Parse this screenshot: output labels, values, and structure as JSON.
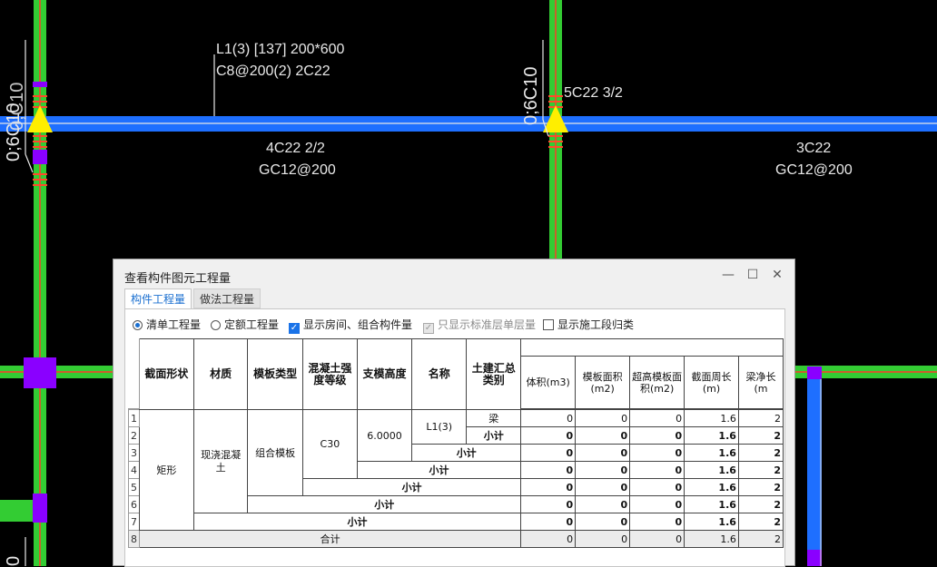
{
  "cad": {
    "beam_label_line1": "L1(3) [137] 200*600",
    "beam_label_line2": "C8@200(2) 2C22",
    "top_rebar_right": "5C22 3/2",
    "bottom_rebar_left": "4C22 2/2",
    "side_rebar_left": "GC12@200",
    "bottom_rebar_right": "3C22",
    "side_rebar_right": "GC12@200",
    "column_left_tag": "0;6C10",
    "column_left_tag_overlap": "0;C10",
    "column_mid_tag": "0;6C10",
    "column_bottom_tag": "0",
    "colors": {
      "beam": "#1e6fff",
      "column": "#33cc33",
      "node": "#8a00ff",
      "rebar": "#ff4a2a",
      "support": "#ffee00"
    }
  },
  "dialog": {
    "title": "查看构件图元工程量",
    "buttons": {
      "minimize": "—",
      "maximize": "☐",
      "close": "✕"
    },
    "tabs": [
      "构件工程量",
      "做法工程量"
    ],
    "options": {
      "radio_bill": "清单工程量",
      "radio_quota": "定额工程量",
      "chk_rooms": "显示房间、组合构件量",
      "chk_std_floor": "只显示标准层单层量",
      "chk_segments": "显示施工段归类"
    },
    "table": {
      "headers": [
        "截面形状",
        "材质",
        "模板类型",
        "混凝土强度等级",
        "支模高度",
        "名称",
        "土建汇总类别",
        "体积(m3)",
        "模板面积(m2)",
        "超高模板面积(m2)",
        "截面周长(m)",
        "梁净长(m"
      ],
      "row_numbers": [
        "1",
        "2",
        "3",
        "4",
        "5",
        "6",
        "7",
        "8"
      ],
      "shape": "矩形",
      "material": "现浇混凝土",
      "formwork": "组合模板",
      "concrete": "C30",
      "height": "6.0000",
      "name": "L1(3)",
      "category": "梁",
      "subtotal": "小计",
      "total": "合计",
      "row_values": [
        "0",
        "0",
        "0",
        "1.6",
        "2"
      ],
      "total_values": [
        "0",
        "0",
        "0",
        "1.6",
        "2"
      ]
    }
  }
}
